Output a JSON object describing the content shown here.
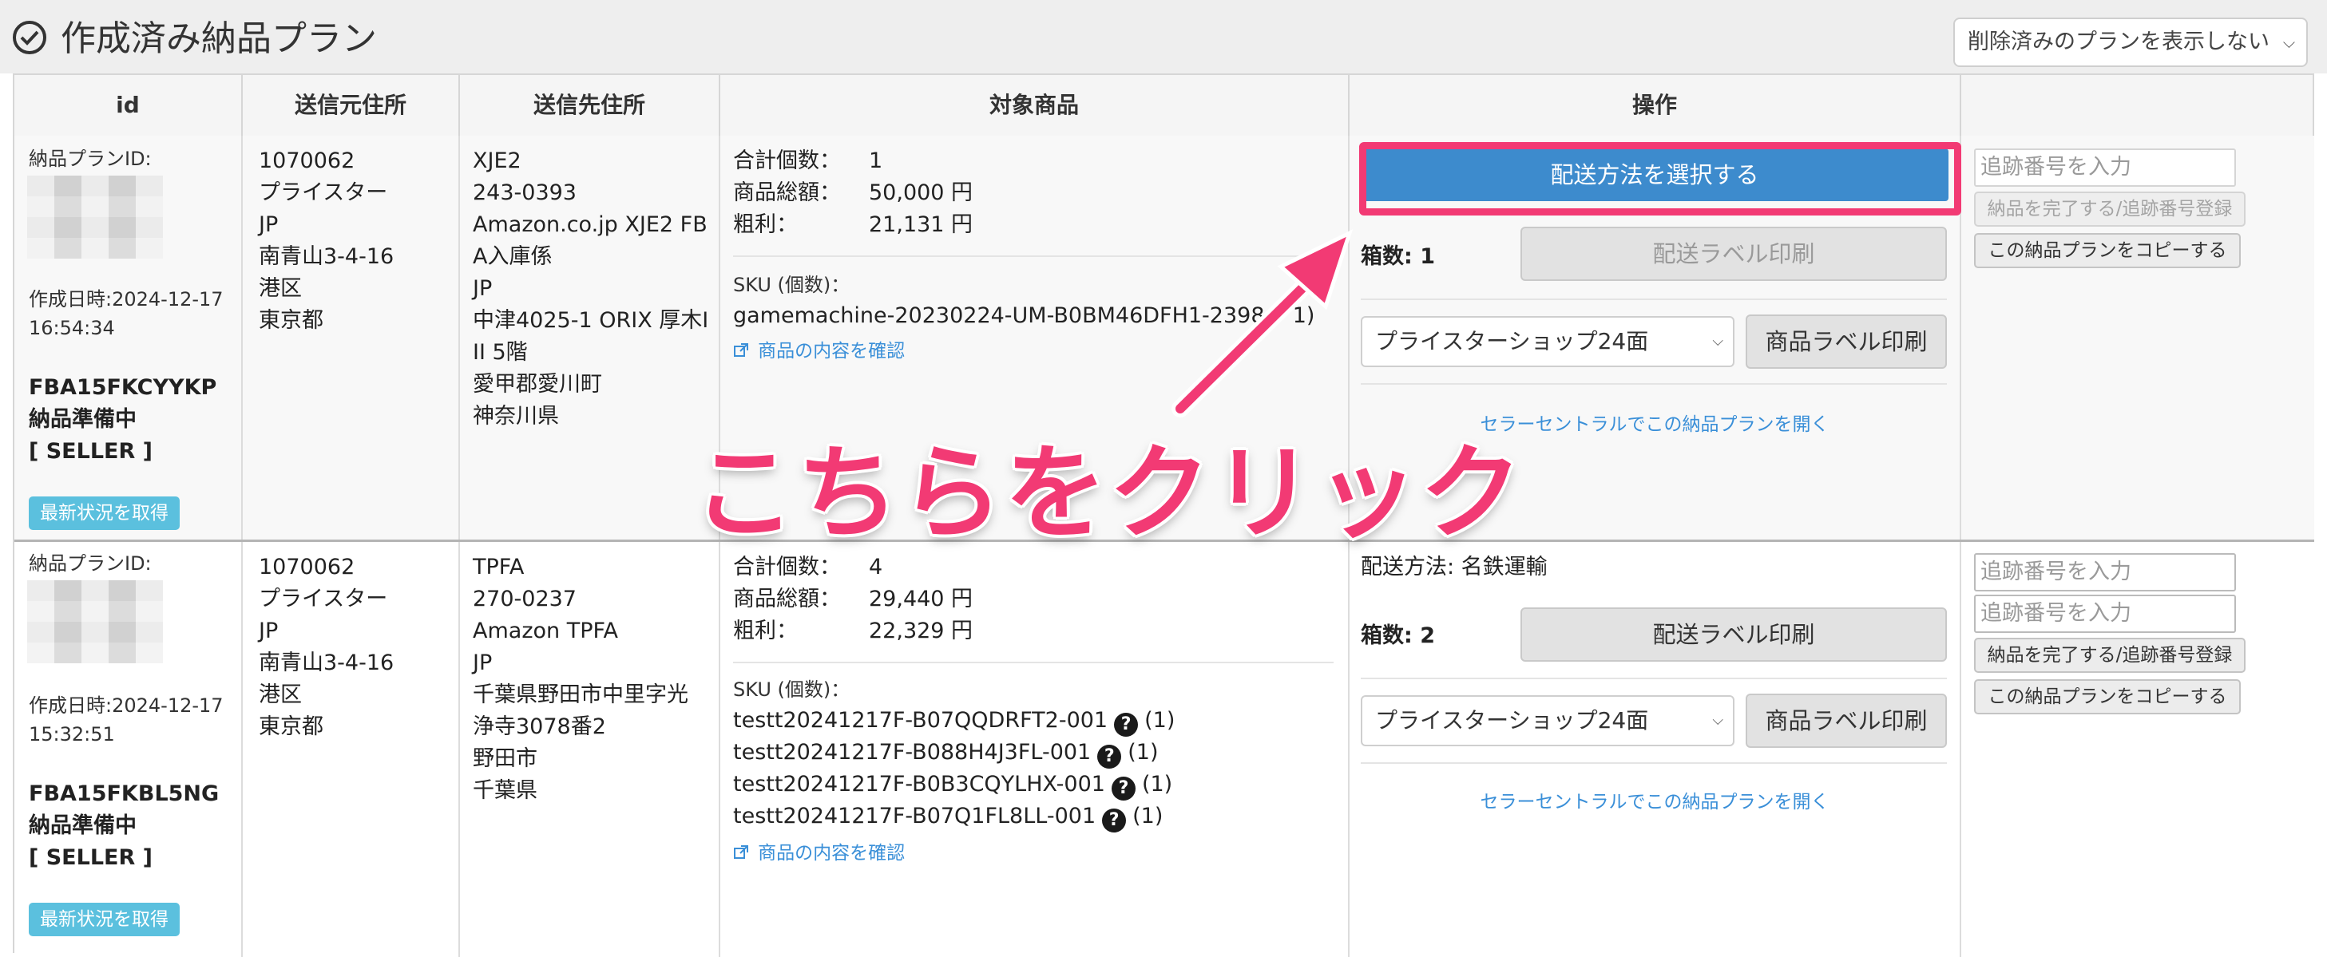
{
  "header": {
    "title": "作成済み納品プラン",
    "filter": "削除済みのプランを表示しない"
  },
  "table": {
    "columns": [
      "id",
      "送信元住所",
      "送信先住所",
      "対象商品",
      "操作"
    ]
  },
  "rows": [
    {
      "plan_id_label": "納品プランID:",
      "created_label": "作成日時:2024-12-17",
      "created_time": "16:54:34",
      "shipment_id": "FBA15FKCYYKP",
      "status": "納品準備中",
      "role": "[ SELLER ]",
      "refresh_button": "最新状況を取得",
      "from_address": [
        "1070062",
        "プライスター",
        "JP",
        "南青山3-4-16",
        "港区",
        "東京都"
      ],
      "to_address": [
        "XJE2",
        "243-0393",
        "Amazon.co.jp XJE2 FB",
        "A入庫係",
        "JP",
        "中津4025-1 ORIX 厚木I",
        "II 5階",
        "愛甲郡愛川町",
        "神奈川県"
      ],
      "stats": [
        {
          "label": "合計個数：",
          "value": "1"
        },
        {
          "label": "商品総額：",
          "value": "50,000 円"
        },
        {
          "label": "粗利：",
          "value": "21,131 円"
        }
      ],
      "sku_label": "SKU (個数)：",
      "skus": [
        {
          "sku": "gamemachine-20230224-UM-B0BM46DFH1-23984",
          "count": "1)"
        }
      ],
      "confirm_link": "商品の内容を確認",
      "shipping_method_button": "配送方法を選択する",
      "boxes": "箱数: 1",
      "shipping_label_button": "配送ラベル印刷",
      "label_select": "プライスターショップ24面",
      "product_label_button": "商品ラベル印刷",
      "seller_central_link": "セラーセントラルでこの納品プランを開く",
      "tracking_placeholder": "追跡番号を入力",
      "complete_button": "納品を完了する/追跡番号登録",
      "copy_button": "この納品プランをコピーする"
    },
    {
      "plan_id_label": "納品プランID:",
      "created_label": "作成日時:2024-12-17",
      "created_time": "15:32:51",
      "shipment_id": "FBA15FKBL5NG",
      "status": "納品準備中",
      "role": "[ SELLER ]",
      "refresh_button": "最新状況を取得",
      "from_address": [
        "1070062",
        "プライスター",
        "JP",
        "南青山3-4-16",
        "港区",
        "東京都"
      ],
      "to_address": [
        "TPFA",
        "270-0237",
        "Amazon TPFA",
        "JP",
        "千葉県野田市中里字光",
        "浄寺3078番2",
        "野田市",
        "千葉県"
      ],
      "stats": [
        {
          "label": "合計個数：",
          "value": "4"
        },
        {
          "label": "商品総額：",
          "value": "29,440 円"
        },
        {
          "label": "粗利：",
          "value": "22,329 円"
        }
      ],
      "sku_label": "SKU (個数)：",
      "skus": [
        {
          "sku": "testt20241217F-B07QQDRFT2-001",
          "count": "(1)"
        },
        {
          "sku": "testt20241217F-B088H4J3FL-001",
          "count": "(1)"
        },
        {
          "sku": "testt20241217F-B0B3CQYLHX-001",
          "count": "(1)"
        },
        {
          "sku": "testt20241217F-B07Q1FL8LL-001",
          "count": "(1)"
        }
      ],
      "confirm_link": "商品の内容を確認",
      "shipping_method_text": "配送方法: 名鉄運輸",
      "boxes": "箱数: 2",
      "shipping_label_button": "配送ラベル印刷",
      "label_select": "プライスターショップ24面",
      "product_label_button": "商品ラベル印刷",
      "seller_central_link": "セラーセントラルでこの納品プランを開く",
      "tracking_placeholder_1": "追跡番号を入力",
      "tracking_placeholder_2": "追跡番号を入力",
      "complete_button": "納品を完了する/追跡番号登録",
      "copy_button": "この納品プランをコピーする"
    }
  ],
  "annotation": {
    "text": "こちらをクリック",
    "color": "#f23a74"
  },
  "colors": {
    "primary_button": "#3d8bcd",
    "info_button": "#5bc0de",
    "link": "#3a8fd8"
  }
}
